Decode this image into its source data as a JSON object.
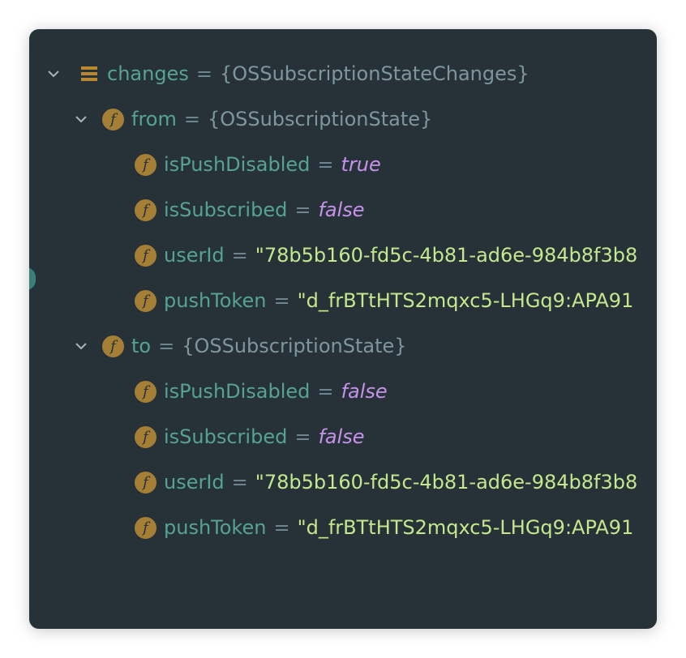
{
  "tree": {
    "root": {
      "name": "changes",
      "eq": "=",
      "type": "{OSSubscriptionStateChanges}",
      "expanded": true,
      "icon": "object-icon"
    },
    "from": {
      "name": "from",
      "eq": "=",
      "type": "{OSSubscriptionState}",
      "expanded": true,
      "badge": "f",
      "fields": [
        {
          "name": "isPushDisabled",
          "eq": "=",
          "value": "true",
          "kind": "bool"
        },
        {
          "name": "isSubscribed",
          "eq": "=",
          "value": "false",
          "kind": "bool"
        },
        {
          "name": "userId",
          "eq": "=",
          "value": "\"78b5b160-fd5c-4b81-ad6e-984b8f3b8",
          "kind": "string"
        },
        {
          "name": "pushToken",
          "eq": "=",
          "value": "\"d_frBTtHTS2mqxc5-LHGq9:APA91",
          "kind": "string"
        }
      ]
    },
    "to": {
      "name": "to",
      "eq": "=",
      "type": "{OSSubscriptionState}",
      "expanded": true,
      "badge": "f",
      "fields": [
        {
          "name": "isPushDisabled",
          "eq": "=",
          "value": "false",
          "kind": "bool"
        },
        {
          "name": "isSubscribed",
          "eq": "=",
          "value": "false",
          "kind": "bool"
        },
        {
          "name": "userId",
          "eq": "=",
          "value": "\"78b5b160-fd5c-4b81-ad6e-984b8f3b8",
          "kind": "string"
        },
        {
          "name": "pushToken",
          "eq": "=",
          "value": "\"d_frBTtHTS2mqxc5-LHGq9:APA91",
          "kind": "string"
        }
      ]
    }
  },
  "colors": {
    "background": "#263238",
    "name": "#56a394",
    "bool": "#c792ea",
    "string": "#c3e88d",
    "badge": "#a57f35"
  }
}
